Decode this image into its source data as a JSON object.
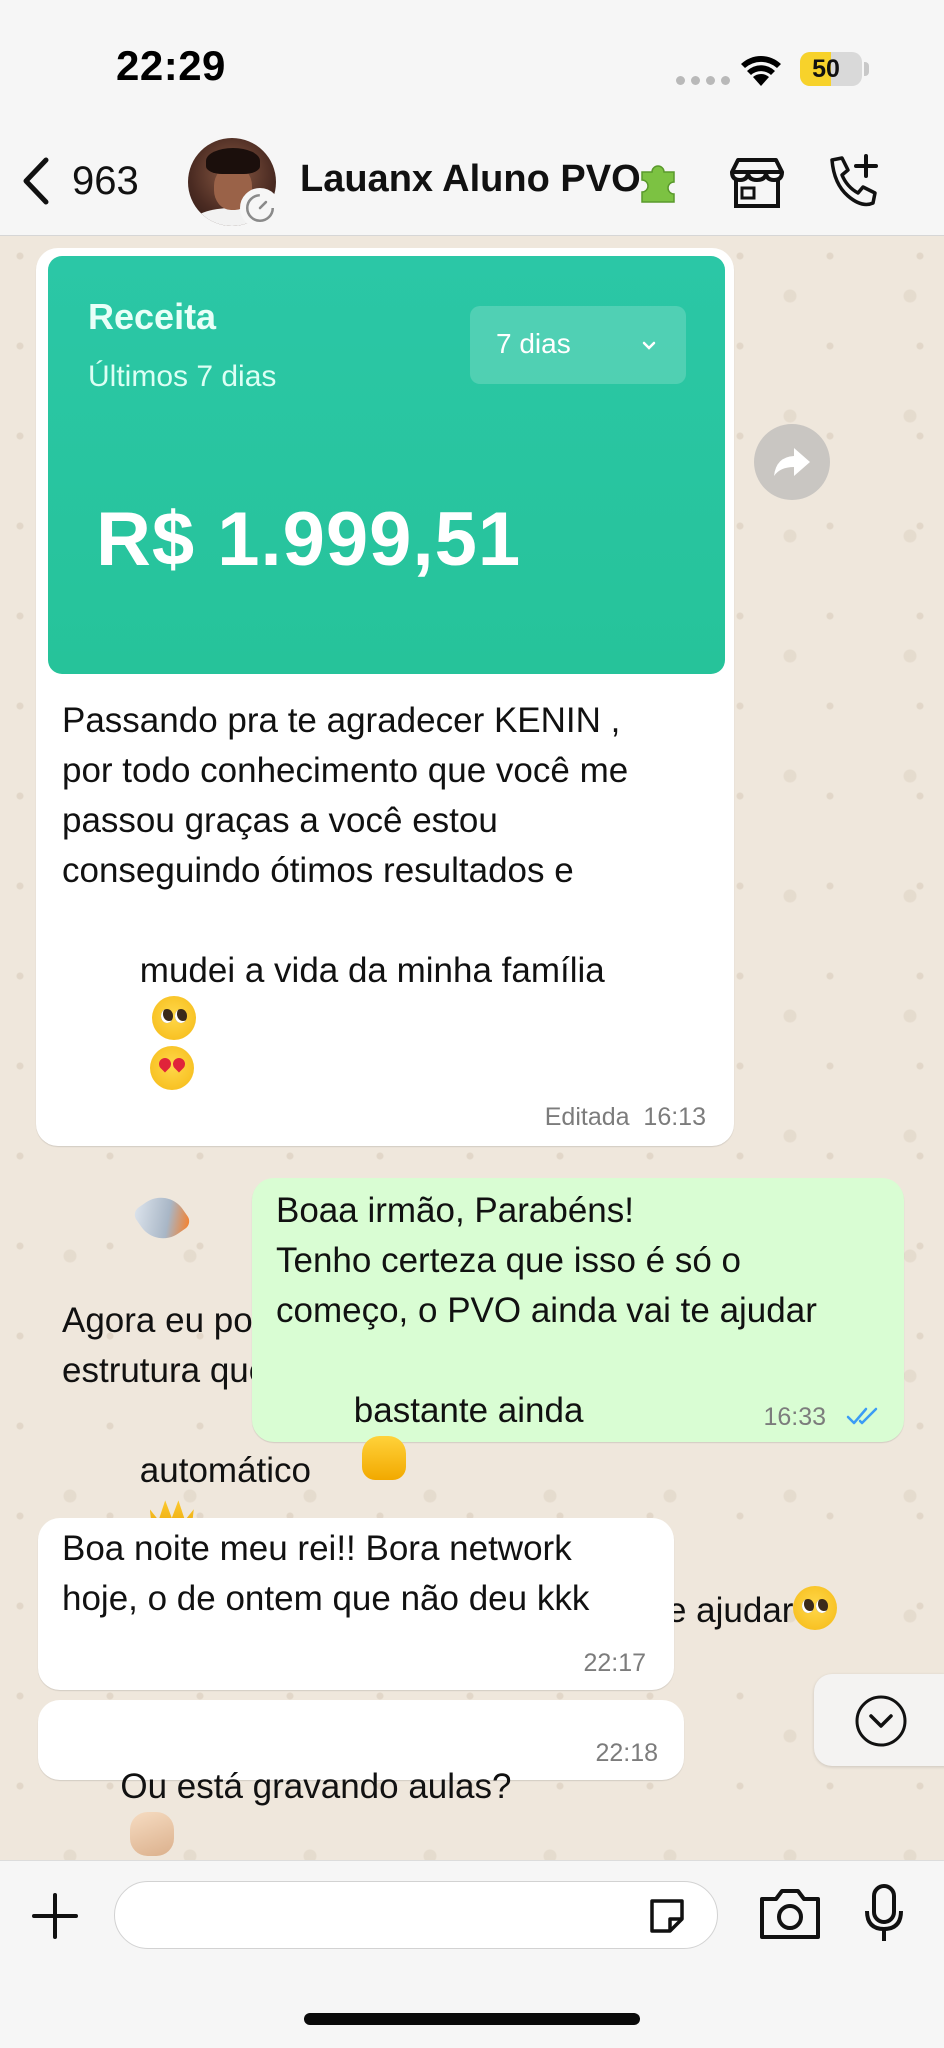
{
  "status_bar": {
    "time": "22:29",
    "battery_level": "50",
    "battery_fraction": 0.5,
    "battery_color": "#f7d22b"
  },
  "header": {
    "back_count": "963",
    "contact_name": "Lauanx Aluno PVO",
    "icons": [
      "back-icon",
      "avatar",
      "timer-icon",
      "puzzle-icon",
      "store-icon",
      "call-add-icon"
    ]
  },
  "messages": {
    "received_1": {
      "card": {
        "title": "Receita",
        "subtitle": "Últimos 7 dias",
        "dropdown_value": "7 dias",
        "amount": "R$ 1.999,51",
        "accent": "#2bc7a6"
      },
      "lines": [
        "Passando pra te agradecer KENIN ,",
        "por todo conhecimento que você me",
        "passou graças a você estou",
        "conseguindo ótimos resultados e",
        "mudei a vida da minha família",
        "Agora eu posso dizer que tenho uma",
        "estrutura que trabalhar para mim no",
        "automático"
      ],
      "meta": "Editada  16:13"
    },
    "sent_1": {
      "lines": [
        "Boaa irmão, Parabéns!",
        "Tenho certeza que isso é só o",
        "começo, o PVO ainda vai te ajudar",
        "bastante ainda",
        "Fico muito feliz por te ajudar"
      ],
      "time": "16:33",
      "status": "read",
      "tick_color": "#3b9cf5"
    },
    "received_2": {
      "lines": [
        "Boa noite meu rei!! Bora network",
        "hoje, o de ontem que não deu kkk"
      ],
      "time": "22:17"
    },
    "received_3": {
      "text": "Ou está gravando aulas?",
      "time": "22:18"
    }
  },
  "input_bar": {
    "placeholder": "",
    "icons": [
      "plus-icon",
      "sticker-icon",
      "camera-icon",
      "mic-icon"
    ]
  },
  "colors": {
    "chat_bg": "#efe7dc",
    "sent_bubble": "#d9fdd3",
    "received_bubble": "#ffffff"
  }
}
